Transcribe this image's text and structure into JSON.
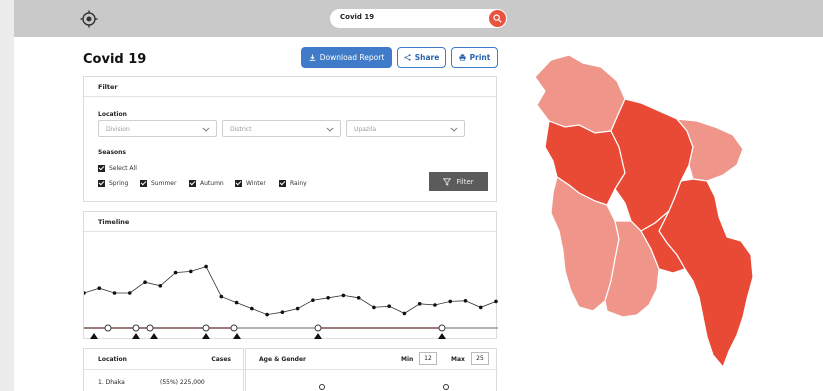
{
  "search": {
    "value": "Covid 19"
  },
  "page": {
    "title": "Covid 19"
  },
  "actions": {
    "download": "Download Report",
    "share": "Share",
    "print": "Print"
  },
  "filter": {
    "heading": "Filter",
    "location_label": "Location",
    "division_placeholder": "Division",
    "district_placeholder": "District",
    "upazila_placeholder": "Upazila",
    "seasons_label": "Seasons",
    "select_all": "Select All",
    "seasons": [
      "Spring",
      "Summer",
      "Autumn",
      "Winter",
      "Rainy"
    ],
    "button": "Filter"
  },
  "timeline": {
    "heading": "Timeline",
    "values": [
      0.3,
      0.38,
      0.3,
      0.3,
      0.48,
      0.42,
      0.64,
      0.66,
      0.74,
      0.24,
      0.14,
      0.04,
      -0.06,
      -0.02,
      0.04,
      0.18,
      0.22,
      0.26,
      0.22,
      0.06,
      0.08,
      -0.04,
      0.12,
      0.1,
      0.16,
      0.17,
      0.06,
      0.16
    ]
  },
  "locations": {
    "col_location": "Location",
    "col_cases": "Cases",
    "rows": [
      {
        "name": "1. Dhaka",
        "cases": "(55%) 225,000"
      }
    ]
  },
  "age_gender": {
    "title": "Age & Gender",
    "min_label": "Min",
    "min_value": "12",
    "max_label": "Max",
    "max_value": "25"
  },
  "colors": {
    "accent": "#3f7bc8",
    "search_button": "#e8553f",
    "map_dark": "#e84a35",
    "map_light": "#f0958a"
  },
  "icons": {
    "logo": "crosshair-logo-icon",
    "search": "search-icon",
    "download": "download-icon",
    "share": "share-icon",
    "print": "printer-icon",
    "filter": "funnel-icon",
    "chevron": "chevron-down-icon"
  }
}
